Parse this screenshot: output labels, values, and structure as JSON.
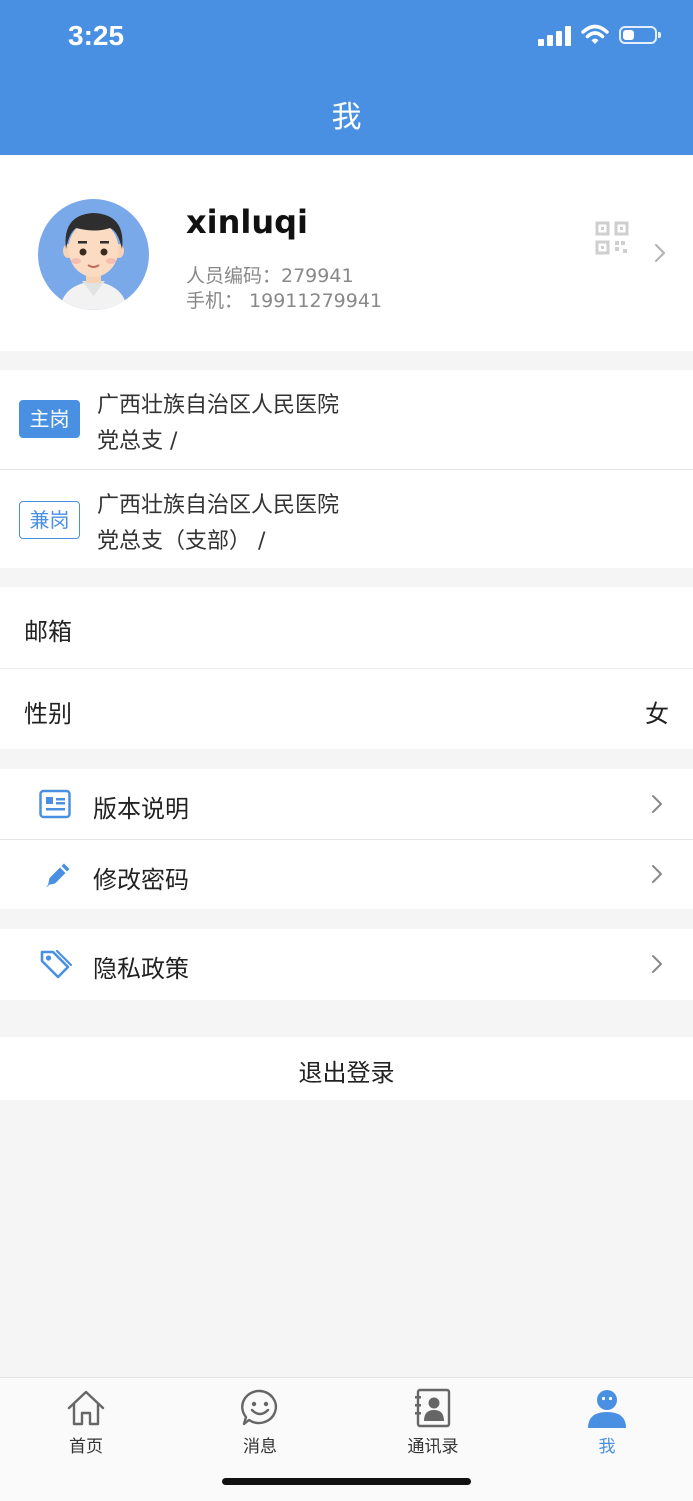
{
  "status_bar": {
    "time": "3:25",
    "battery_level": 0.35
  },
  "header": {
    "title": "我"
  },
  "profile": {
    "name": "xinluqi",
    "staff_code": "人员编码：279941",
    "phone": "手机：  19911279941",
    "qr_icon": "qr-code-icon"
  },
  "departments": [
    {
      "tag": "主岗",
      "org": "广西壮族自治区人民医院",
      "dept": "党总支    /"
    },
    {
      "tag": "兼岗",
      "org": "广西壮族自治区人民医院",
      "dept": "党总支（支部）   /"
    }
  ],
  "info": {
    "email_label": "邮箱",
    "email_value": "",
    "gender_label": "性别",
    "gender_value": "女"
  },
  "menu": [
    {
      "label": "版本说明",
      "icon": "document-icon"
    },
    {
      "label": "修改密码",
      "icon": "pencil-icon"
    },
    {
      "label": "隐私政策",
      "icon": "tag-icon"
    }
  ],
  "logout_label": "退出登录",
  "tabs": [
    {
      "label": "首页",
      "icon": "home-icon",
      "active": false
    },
    {
      "label": "消息",
      "icon": "chat-icon",
      "active": false
    },
    {
      "label": "通讯录",
      "icon": "contacts-icon",
      "active": false
    },
    {
      "label": "我",
      "icon": "person-icon",
      "active": true
    }
  ],
  "colors": {
    "accent": "#4a90e2",
    "background": "#f5f5f5"
  }
}
